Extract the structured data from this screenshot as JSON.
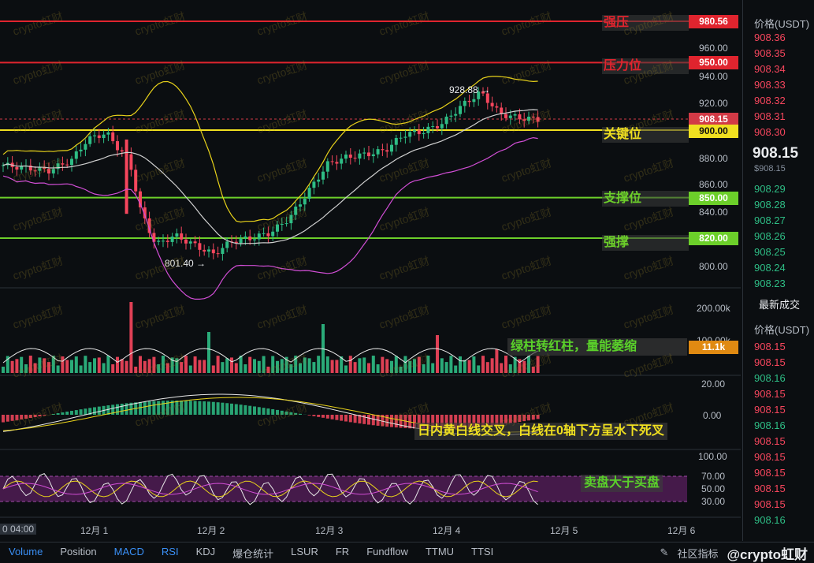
{
  "colors": {
    "up": "#2ebd85",
    "down": "#f6465d",
    "resistance": "#e0242e",
    "key": "#f0e020",
    "support": "#6ccf2a",
    "boll_upper": "#e8d21a",
    "boll_mid": "#d0d0d0",
    "boll_lower": "#d24ed6",
    "rsi_band": "#5a1f5e"
  },
  "price_axis": {
    "ticks": [
      "960.00",
      "940.00",
      "920.00",
      "880.00",
      "860.00",
      "840.00",
      "800.00"
    ]
  },
  "levels": [
    {
      "name": "强压",
      "price": 980.56,
      "tag": "980.56",
      "kind": "resistance"
    },
    {
      "name": "压力位",
      "price": 950.0,
      "tag": "950.00",
      "kind": "resistance"
    },
    {
      "name": "关键位",
      "price": 900.0,
      "tag": "900.00",
      "kind": "key"
    },
    {
      "name": "支撑位",
      "price": 850.0,
      "tag": "850.00",
      "kind": "support"
    },
    {
      "name": "强撑",
      "price": 820.0,
      "tag": "820.00",
      "kind": "support"
    }
  ],
  "current_price_tag": "908.15",
  "high_label": "928.88 →",
  "low_label": "801.40 →",
  "volume_axis": {
    "ticks": [
      "200.00k",
      "100.00k"
    ],
    "current_tag": "11.1k"
  },
  "macd_axis": {
    "ticks": [
      "20.00",
      "0.00"
    ]
  },
  "rsi_axis": {
    "ticks": [
      "100.00",
      "70.00",
      "50.00",
      "30.00"
    ]
  },
  "annotations": {
    "volume": "绿柱转红柱，量能萎缩",
    "macd": "日内黄白线交叉，白线在0轴下方呈水下死叉",
    "rsi": "卖盘大于买盘"
  },
  "x_dates": [
    "0 04:00",
    "12月 1",
    "12月 2",
    "12月 3",
    "12月 4",
    "12月 5",
    "12月 6"
  ],
  "watermark": "crypto虹财",
  "orderbook": {
    "header_price": "价格(USDT)",
    "asks": [
      "908.36",
      "908.35",
      "908.34",
      "908.33",
      "908.32",
      "908.31",
      "908.30"
    ],
    "mid_price": "908.15",
    "mid_sub": "$908.15",
    "bids": [
      "908.29",
      "908.28",
      "908.27",
      "908.26",
      "908.25",
      "908.24",
      "908.23"
    ],
    "trades_title": "最新成交",
    "trades_header": "价格(USDT)",
    "trades": [
      {
        "p": "908.15",
        "c": "down"
      },
      {
        "p": "908.15",
        "c": "down"
      },
      {
        "p": "908.16",
        "c": "up"
      },
      {
        "p": "908.15",
        "c": "down"
      },
      {
        "p": "908.15",
        "c": "down"
      },
      {
        "p": "908.16",
        "c": "up"
      },
      {
        "p": "908.15",
        "c": "down"
      },
      {
        "p": "908.15",
        "c": "down"
      },
      {
        "p": "908.15",
        "c": "down"
      },
      {
        "p": "908.15",
        "c": "down"
      },
      {
        "p": "908.15",
        "c": "down"
      },
      {
        "p": "908.16",
        "c": "up"
      }
    ]
  },
  "toolbar": {
    "items": [
      {
        "label": "Volume",
        "active": true
      },
      {
        "label": "Position",
        "active": false
      },
      {
        "label": "MACD",
        "active": true
      },
      {
        "label": "RSI",
        "active": true
      },
      {
        "label": "KDJ",
        "active": false
      },
      {
        "label": "爆仓统计",
        "active": false
      },
      {
        "label": "LSUR",
        "active": false
      },
      {
        "label": "FR",
        "active": false
      },
      {
        "label": "Fundflow",
        "active": false
      },
      {
        "label": "TTMU",
        "active": false
      },
      {
        "label": "TTSI",
        "active": false
      }
    ],
    "right_label": "社区指标",
    "brand": "@crypto虹财"
  }
}
